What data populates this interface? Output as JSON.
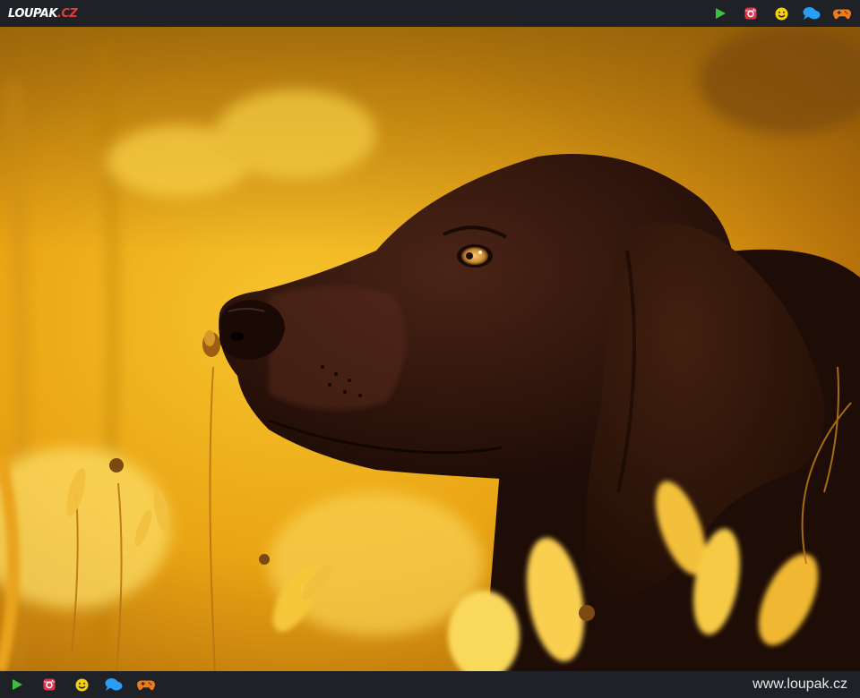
{
  "header": {
    "logo_main": "LOUPAK",
    "logo_tld": ".CZ",
    "icons": [
      "play-icon",
      "instagram-icon",
      "smiley-icon",
      "chat-icon",
      "gamepad-icon"
    ]
  },
  "photo": {
    "subject": "dog-in-golden-field"
  },
  "footer": {
    "icons": [
      "play-icon",
      "instagram-icon",
      "smiley-icon",
      "chat-icon",
      "gamepad-icon"
    ],
    "site_url": "www.loupak.cz"
  },
  "colors": {
    "bar": "#1e2126",
    "play": "#3fbf3f",
    "instagram": "#e0334a",
    "smiley": "#f5d10a",
    "chat": "#2a9df4",
    "gamepad": "#f07a1a",
    "logo_accent": "#e53935"
  }
}
